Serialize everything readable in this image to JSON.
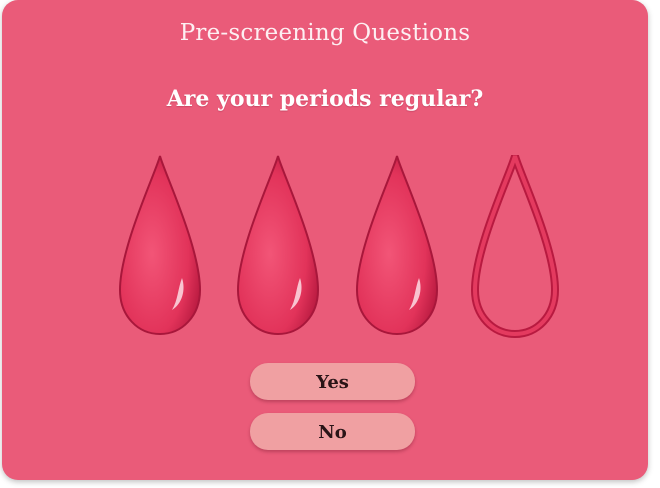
{
  "screen": {
    "title": "Pre-screening Questions",
    "question": "Are your periods regular?"
  },
  "rating": {
    "icon": "blood-drop-icon",
    "max": 4,
    "value": 3
  },
  "answers": {
    "yes_label": "Yes",
    "no_label": "No"
  },
  "colors": {
    "background": "#ea5b79",
    "drop_fill": "#e8385e",
    "drop_dark": "#c21f45",
    "button_fill": "#f0a0a2",
    "title_text": "#fdeff2"
  }
}
